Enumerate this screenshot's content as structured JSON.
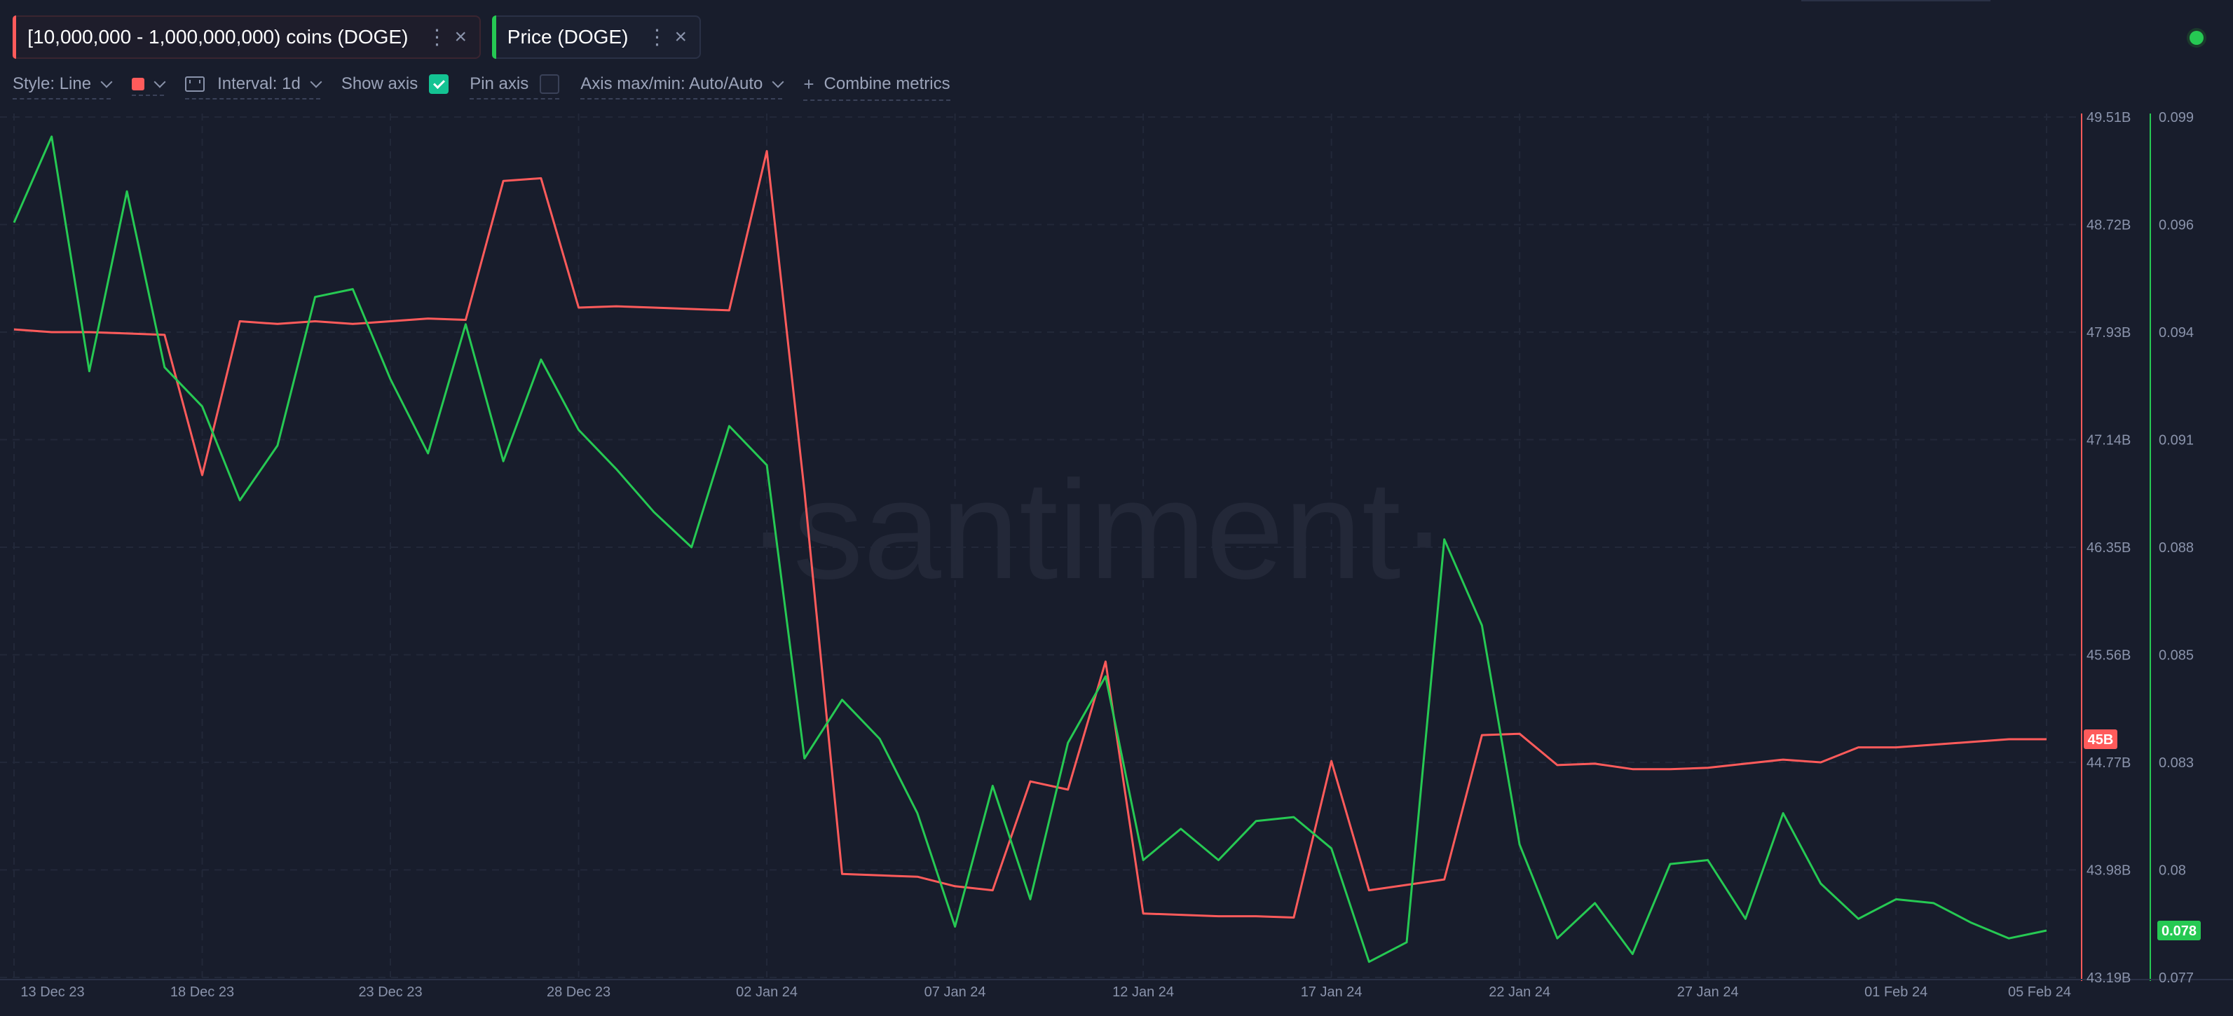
{
  "metrics": [
    {
      "label": "[10,000,000 - 1,000,000,000) coins (DOGE)",
      "color": "#ff5b5b"
    },
    {
      "label": "Price (DOGE)",
      "color": "#26c953"
    }
  ],
  "toolbar": {
    "style_label": "Style: Line",
    "interval_label": "Interval: 1d",
    "show_axis_label": "Show axis",
    "pin_axis_label": "Pin axis",
    "axis_maxmin_label": "Axis max/min: Auto/Auto",
    "combine_label": "Combine metrics",
    "show_axis_checked": true,
    "pin_axis_checked": false
  },
  "watermark": "·santiment·",
  "chart_data": {
    "type": "line",
    "x": [
      "2023-12-13",
      "2023-12-14",
      "2023-12-15",
      "2023-12-16",
      "2023-12-17",
      "2023-12-18",
      "2023-12-19",
      "2023-12-20",
      "2023-12-21",
      "2023-12-22",
      "2023-12-23",
      "2023-12-24",
      "2023-12-25",
      "2023-12-26",
      "2023-12-27",
      "2023-12-28",
      "2023-12-29",
      "2023-12-30",
      "2023-12-31",
      "2024-01-01",
      "2024-01-02",
      "2024-01-03",
      "2024-01-04",
      "2024-01-05",
      "2024-01-06",
      "2024-01-07",
      "2024-01-08",
      "2024-01-09",
      "2024-01-10",
      "2024-01-11",
      "2024-01-12",
      "2024-01-13",
      "2024-01-14",
      "2024-01-15",
      "2024-01-16",
      "2024-01-17",
      "2024-01-18",
      "2024-01-19",
      "2024-01-20",
      "2024-01-21",
      "2024-01-22",
      "2024-01-23",
      "2024-01-24",
      "2024-01-25",
      "2024-01-26",
      "2024-01-27",
      "2024-01-28",
      "2024-01-29",
      "2024-01-30",
      "2024-01-31",
      "2024-02-01",
      "2024-02-02",
      "2024-02-03",
      "2024-02-04",
      "2024-02-05"
    ],
    "x_tick_labels": [
      "13 Dec 23",
      "18 Dec 23",
      "23 Dec 23",
      "28 Dec 23",
      "02 Jan 24",
      "07 Jan 24",
      "12 Jan 24",
      "17 Jan 24",
      "22 Jan 24",
      "27 Jan 24",
      "01 Feb 24",
      "05 Feb 24"
    ],
    "x_tick_index": [
      0,
      5,
      10,
      15,
      20,
      25,
      30,
      35,
      40,
      45,
      50,
      54
    ],
    "series": [
      {
        "name": "[10,000,000 - 1,000,000,000) coins (DOGE)",
        "color": "#ff5b5b",
        "axis": "left",
        "unit": "B",
        "values": [
          47.95,
          47.93,
          47.93,
          47.92,
          47.91,
          46.88,
          48.01,
          47.99,
          48.01,
          47.99,
          48.01,
          48.03,
          48.02,
          49.04,
          49.06,
          48.11,
          48.12,
          48.11,
          48.1,
          48.09,
          49.26,
          46.76,
          43.95,
          43.94,
          43.93,
          43.86,
          43.83,
          44.63,
          44.57,
          45.51,
          43.66,
          43.65,
          43.64,
          43.64,
          43.63,
          44.78,
          43.83,
          43.87,
          43.91,
          44.97,
          44.98,
          44.75,
          44.76,
          44.72,
          44.72,
          44.73,
          44.76,
          44.79,
          44.77,
          44.88,
          44.88,
          44.9,
          44.92,
          44.94,
          44.94
        ],
        "last_value_label": "45B"
      },
      {
        "name": "Price (DOGE)",
        "color": "#26c953",
        "axis": "right",
        "values": [
          0.0963,
          0.0985,
          0.0925,
          0.0971,
          0.0926,
          0.0916,
          0.0892,
          0.0906,
          0.0944,
          0.0946,
          0.0923,
          0.0904,
          0.0937,
          0.0902,
          0.0928,
          0.091,
          0.09,
          0.0889,
          0.088,
          0.0911,
          0.0901,
          0.0826,
          0.0841,
          0.0831,
          0.0812,
          0.0783,
          0.0819,
          0.079,
          0.083,
          0.0847,
          0.08,
          0.0808,
          0.08,
          0.081,
          0.0811,
          0.0803,
          0.0774,
          0.0779,
          0.0882,
          0.086,
          0.0804,
          0.078,
          0.0789,
          0.0776,
          0.0799,
          0.08,
          0.0785,
          0.0812,
          0.0794,
          0.0785,
          0.079,
          0.0789,
          0.0784,
          0.078,
          0.0782
        ],
        "last_value_label": "0.078"
      }
    ],
    "left_axis": {
      "ticks": [
        "49.51B",
        "48.72B",
        "47.93B",
        "47.14B",
        "46.35B",
        "45.56B",
        "44.77B",
        "43.98B",
        "43.19B"
      ],
      "ylim": [
        43.19,
        49.51
      ]
    },
    "right_axis": {
      "ticks": [
        "0.099",
        "0.096",
        "0.094",
        "0.091",
        "0.088",
        "0.085",
        "0.083",
        "0.08",
        "0.077"
      ],
      "ylim": [
        0.077,
        0.099
      ]
    },
    "grid": true
  }
}
